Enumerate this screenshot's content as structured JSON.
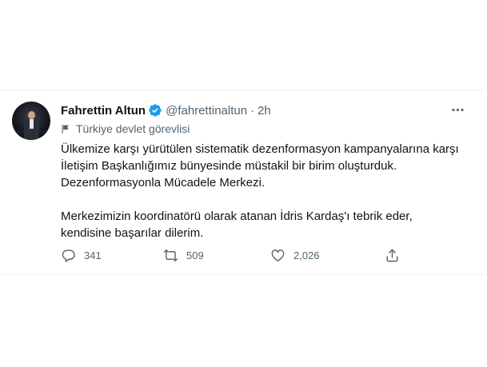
{
  "tweet": {
    "author_name": "Fahrettin Altun",
    "handle": "@fahrettinaltun",
    "separator": "·",
    "time": "2h",
    "label": "Türkiye devlet görevlisi",
    "text_lines": [
      "Ülkemize karşı yürütülen sistematik dezenformasyon kampanyalarına karşı",
      "İletişim Başkanlığımız bünyesinde müstakil bir birim oluşturduk.",
      "Dezenformasyonla Mücadele Merkezi.",
      "Merkezimizin koordinatörü olarak atanan İdris Kardaş'ı tebrik eder,",
      "kendisine başarılar dilerim."
    ],
    "replies": "341",
    "retweets": "509",
    "likes": "2,026"
  },
  "icons": {
    "verified": "verified-badge-icon",
    "more": "more-options-icon",
    "label": "flag-icon",
    "reply": "reply-icon",
    "retweet": "retweet-icon",
    "like": "heart-icon",
    "share": "share-icon"
  },
  "colors": {
    "verified": "#1d9bf0",
    "secondary_text": "#536471",
    "primary_text": "#0f1419"
  }
}
